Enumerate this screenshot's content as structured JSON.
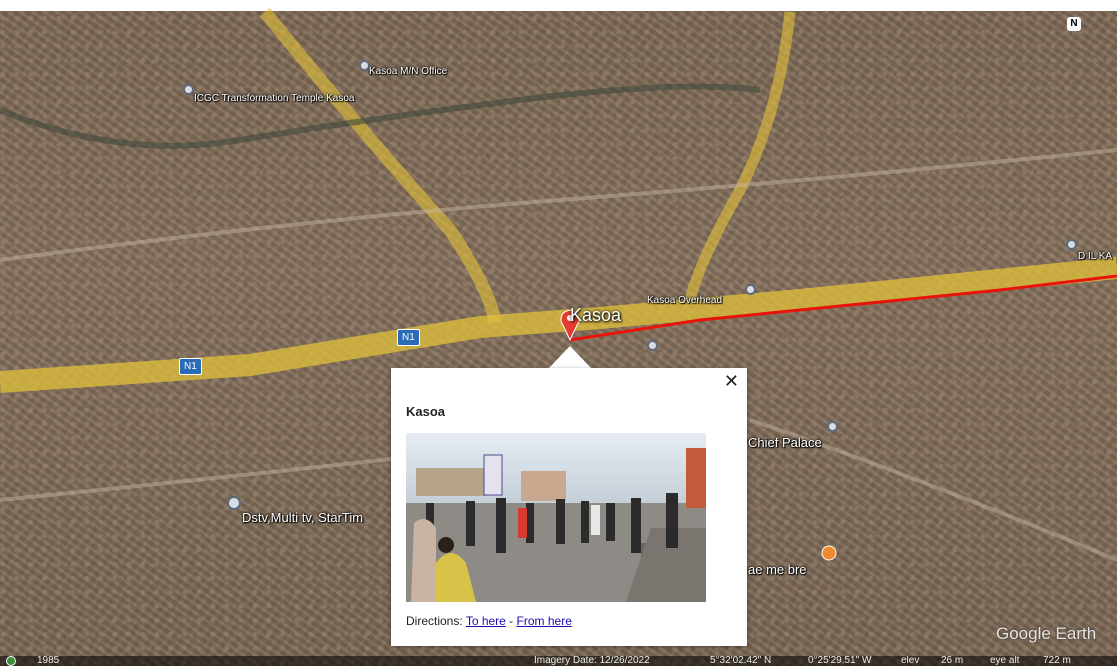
{
  "map": {
    "labels": {
      "office": "Kasoa M/N Office",
      "temple": "ICGC Transformation Temple Kasoa",
      "overhead": "Kasoa Overhead",
      "dstv": "Dstv,Multi tv, StarTim",
      "palace": "Chief Palace",
      "bre": "ae me bre",
      "right_edge": "D IL KA"
    },
    "road_shield": "N1",
    "road_shield_2": "N1",
    "placemark_title": "Kasoa",
    "north": "N"
  },
  "popup": {
    "title": "Kasoa",
    "close": "✕",
    "directions_label": "Directions:",
    "to_here": "To here",
    "separator": " - ",
    "from_here": "From here"
  },
  "status": {
    "year": "1985",
    "imagery_date": "Imagery Date: 12/26/2022",
    "lat": "5°32'02.42\" N",
    "lon": "0°25'29.51\" W",
    "elev": "elev",
    "elev_val": "26 m",
    "eye_alt": "eye alt",
    "eye_alt_val": "722 m"
  },
  "watermark": "Google Earth",
  "colors": {
    "route": "#e8140c",
    "highway": "#e2c23a",
    "shield": "#2a6bb5"
  }
}
